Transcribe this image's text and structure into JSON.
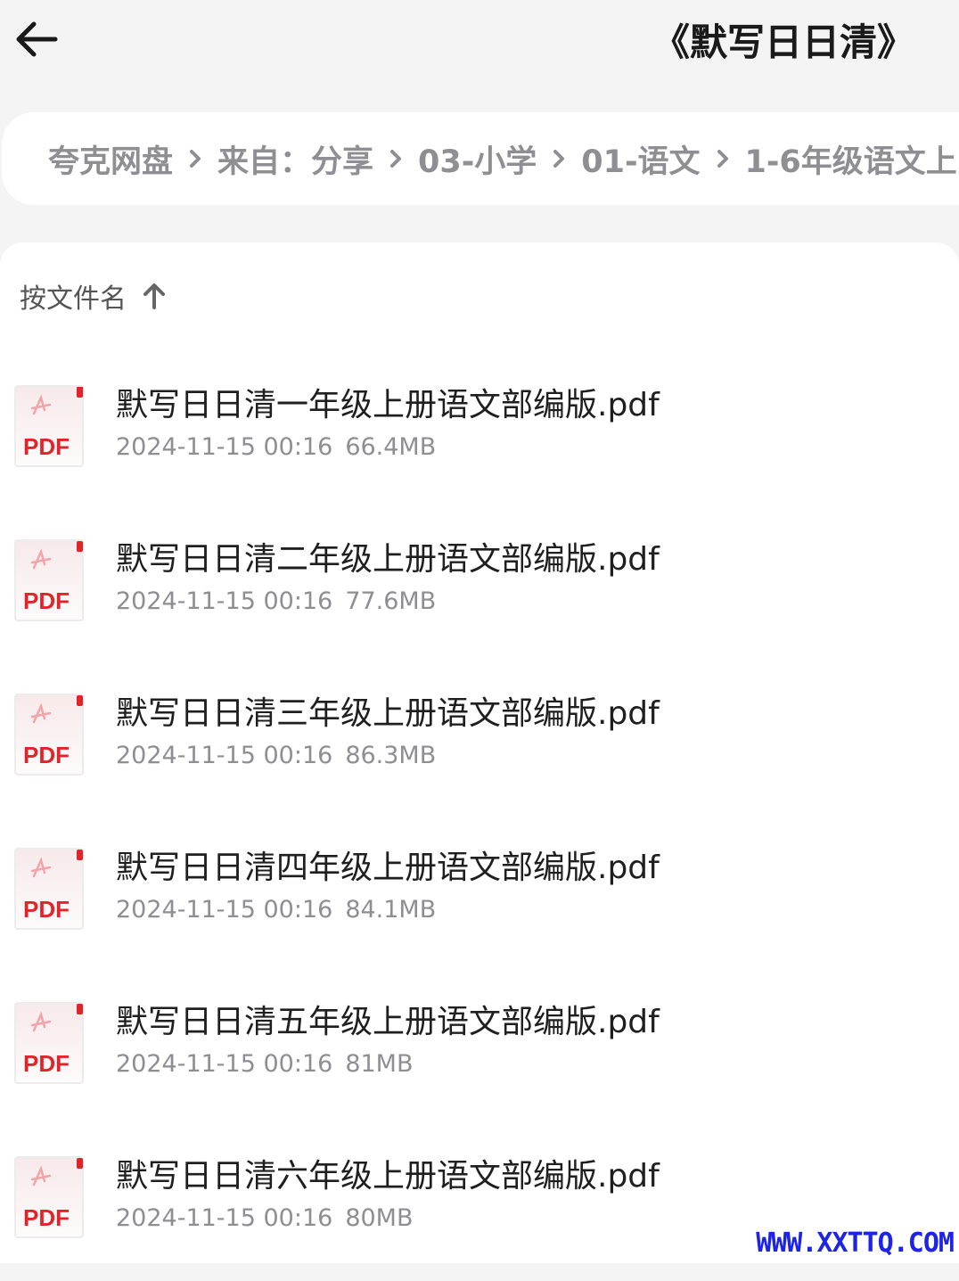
{
  "header": {
    "title": "《默写日日清》",
    "back_icon": "arrow-left-icon"
  },
  "breadcrumb": [
    "夸克网盘",
    "来自：分享",
    "03-小学",
    "01-语文",
    "1-6年级语文上"
  ],
  "sort": {
    "label": "按文件名",
    "direction_icon": "arrow-up-icon"
  },
  "files": [
    {
      "name": "默写日日清一年级上册语文部编版.pdf",
      "date": "2024-11-15 00:16",
      "size": "66.4MB",
      "type": "PDF"
    },
    {
      "name": "默写日日清二年级上册语文部编版.pdf",
      "date": "2024-11-15 00:16",
      "size": "77.6MB",
      "type": "PDF"
    },
    {
      "name": "默写日日清三年级上册语文部编版.pdf",
      "date": "2024-11-15 00:16",
      "size": "86.3MB",
      "type": "PDF"
    },
    {
      "name": "默写日日清四年级上册语文部编版.pdf",
      "date": "2024-11-15 00:16",
      "size": "84.1MB",
      "type": "PDF"
    },
    {
      "name": "默写日日清五年级上册语文部编版.pdf",
      "date": "2024-11-15 00:16",
      "size": "81MB",
      "type": "PDF"
    },
    {
      "name": "默写日日清六年级上册语文部编版.pdf",
      "date": "2024-11-15 00:16",
      "size": "80MB",
      "type": "PDF"
    }
  ],
  "watermark": "WWW.XXTTQ.COM",
  "colors": {
    "page_bg": "#f4f4f5",
    "pdf_red": "#e0242a",
    "meta_gray": "#8e8e93",
    "watermark_blue": "#1d24e6"
  }
}
